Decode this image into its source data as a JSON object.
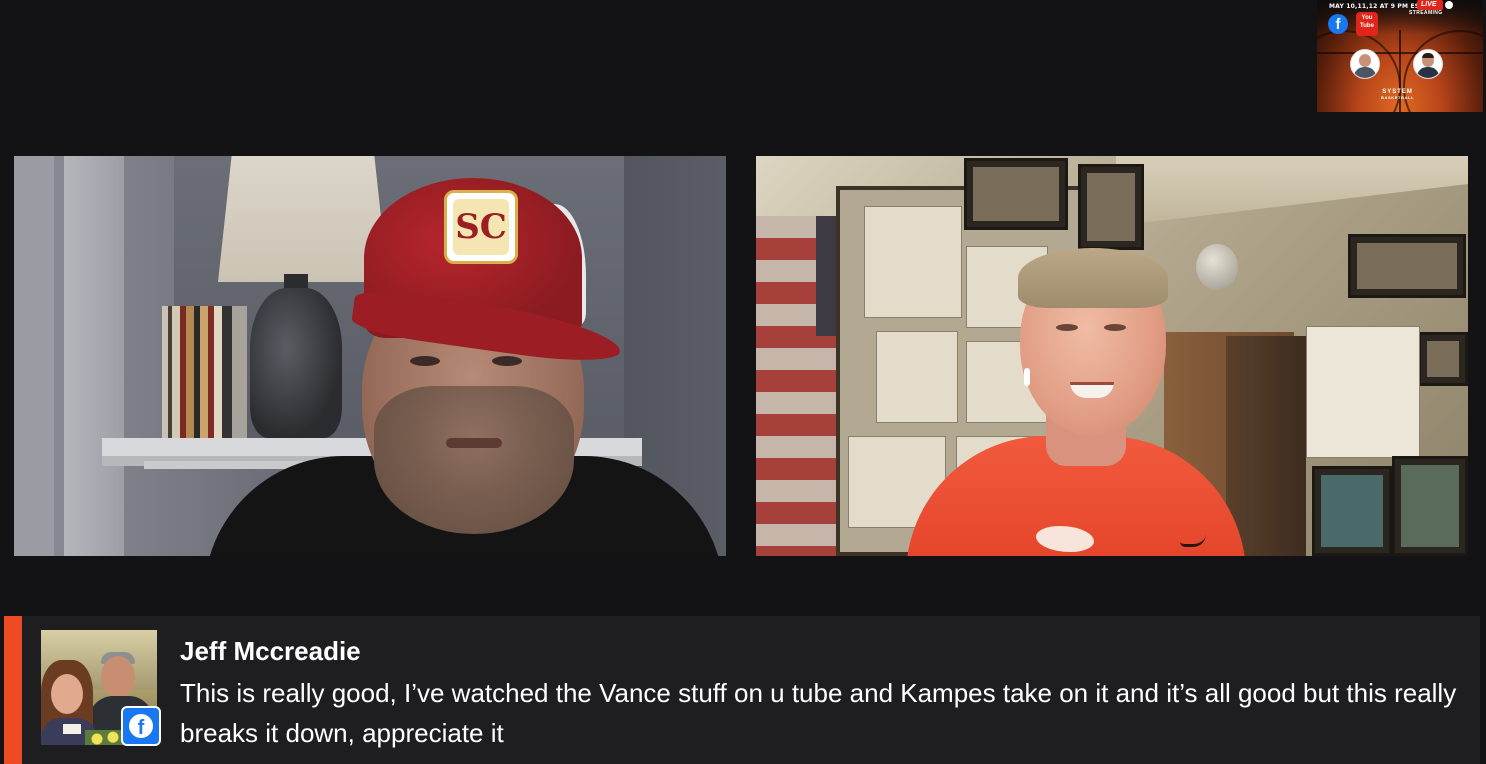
{
  "promo": {
    "date_text": "MAY 10,11,12 AT 9 PM EST",
    "live_label": "LIVE",
    "streaming_label": "STREAMING",
    "facebook_icon": "facebook-icon",
    "youtube_label": "You Tube",
    "brand_line1": "SYSTEM",
    "brand_line2": "BASKETBALL"
  },
  "participants": [
    {
      "position": "left",
      "hat_logo": "SC"
    },
    {
      "position": "right"
    }
  ],
  "comment": {
    "author": "Jeff Mccreadie",
    "text": "This is really good, I’ve watched the Vance stuff on u tube and Kampes take on it and it’s all good but this really breaks it down, appreciate it",
    "source_icon": "facebook-icon",
    "accent_color": "#ec4b24",
    "badge_color": "#1a77f2"
  }
}
